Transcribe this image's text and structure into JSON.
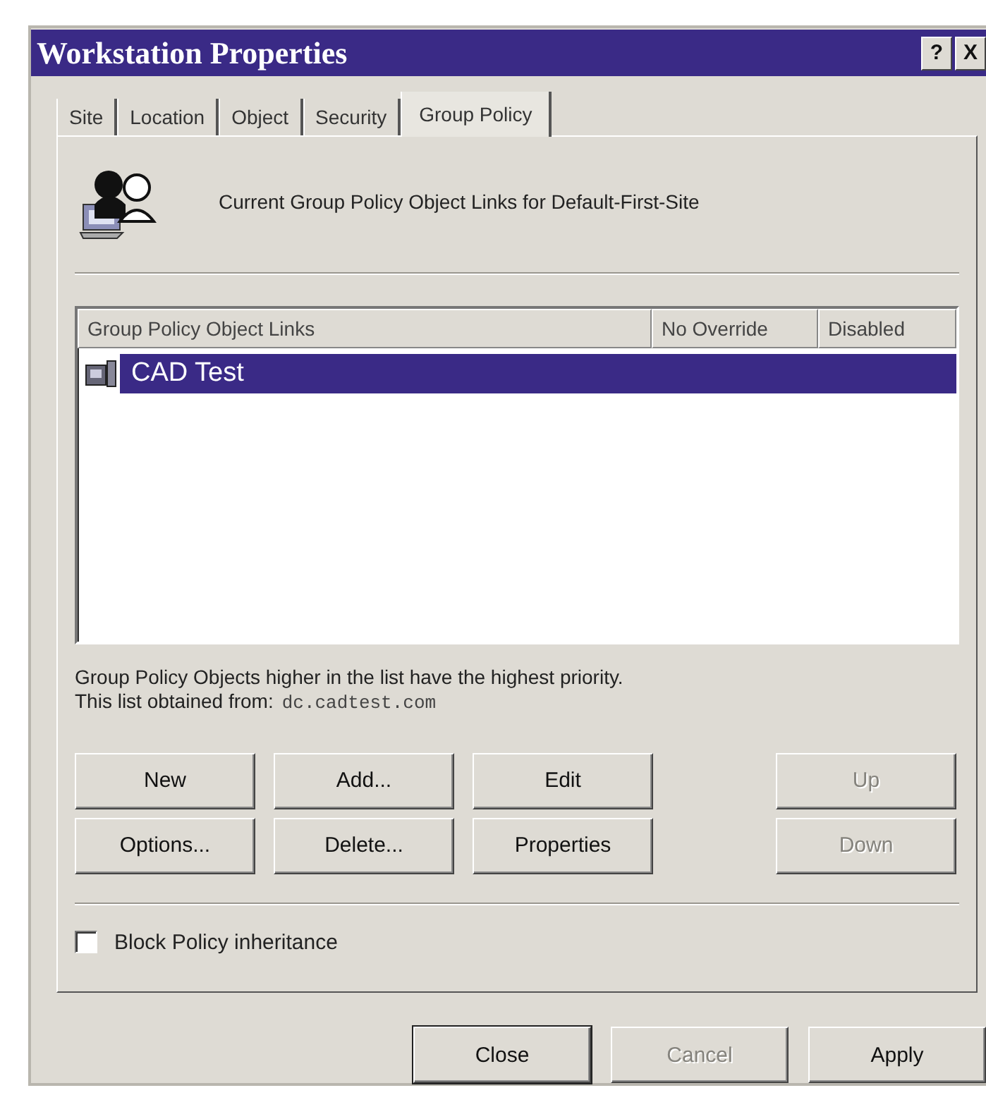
{
  "window": {
    "title": "Workstation Properties",
    "title_buttons": [
      "?",
      "X"
    ]
  },
  "tabs": [
    {
      "label": "Site",
      "selected": false
    },
    {
      "label": "Location",
      "selected": false
    },
    {
      "label": "Object",
      "selected": false
    },
    {
      "label": "Security",
      "selected": false
    },
    {
      "label": "Group Policy",
      "selected": true
    }
  ],
  "header": {
    "text": "Current Group Policy Object Links for Default-First-Site"
  },
  "links_list": {
    "columns": [
      "Group Policy Object Links",
      "No Override",
      "Disabled"
    ],
    "rows": [
      {
        "name": "CAD Test",
        "selected": true
      }
    ]
  },
  "priority_note": "Group Policy Objects higher in the list have the highest priority.",
  "source": {
    "label": "This list obtained from:",
    "server": "dc.cadtest.com"
  },
  "buttons": [
    [
      {
        "label": "New",
        "disabled": false
      },
      {
        "label": "Add...",
        "disabled": false
      },
      {
        "label": "Edit",
        "disabled": false
      },
      {
        "label": "Up",
        "disabled": true
      }
    ],
    [
      {
        "label": "Options...",
        "disabled": false
      },
      {
        "label": "Delete...",
        "disabled": false
      },
      {
        "label": "Properties",
        "disabled": false
      },
      {
        "label": "Down",
        "disabled": true
      }
    ]
  ],
  "block_inheritance": {
    "label": "Block Policy inheritance",
    "checked": false
  },
  "dialog_buttons": [
    {
      "label": "Close",
      "disabled": false,
      "default": true
    },
    {
      "label": "Cancel",
      "disabled": true,
      "default": false
    },
    {
      "label": "Apply",
      "disabled": false,
      "default": false
    }
  ]
}
